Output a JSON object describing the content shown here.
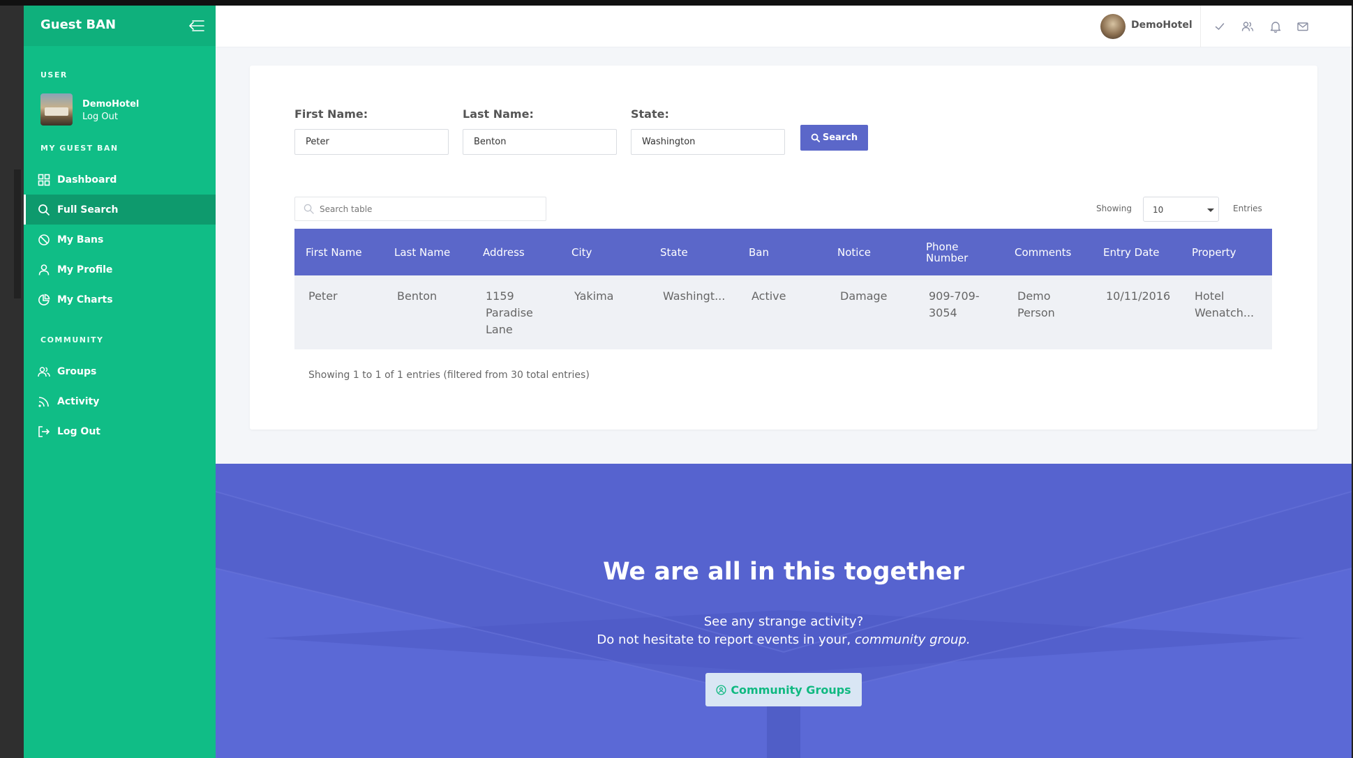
{
  "sidebar": {
    "brand": "Guest BAN",
    "user_section": "USER",
    "user": {
      "name": "DemoHotel",
      "logout": "Log Out"
    },
    "my_section": "MY GUEST BAN",
    "my_items": [
      {
        "label": "Dashboard",
        "icon": "dashboard-icon"
      },
      {
        "label": "Full Search",
        "icon": "search-icon",
        "active": true
      },
      {
        "label": "My Bans",
        "icon": "ban-icon"
      },
      {
        "label": "My Profile",
        "icon": "user-icon"
      },
      {
        "label": "My Charts",
        "icon": "pie-chart-icon"
      }
    ],
    "community_section": "COMMUNITY",
    "community_items": [
      {
        "label": "Groups",
        "icon": "users-icon"
      },
      {
        "label": "Activity",
        "icon": "rss-icon"
      },
      {
        "label": "Log Out",
        "icon": "logout-icon"
      }
    ]
  },
  "topbar": {
    "username": "DemoHotel",
    "icons": [
      "check-icon",
      "users-icon",
      "bell-icon",
      "mail-icon"
    ]
  },
  "search_form": {
    "first_name_label": "First Name:",
    "first_name_value": "Peter",
    "last_name_label": "Last Name:",
    "last_name_value": "Benton",
    "state_label": "State:",
    "state_value": "Washington",
    "search_button": "Search"
  },
  "table_controls": {
    "search_placeholder": "Search table",
    "showing_label": "Showing",
    "entries_value": "10",
    "entries_label": "Entries"
  },
  "table": {
    "columns": [
      "First Name",
      "Last Name",
      "Address",
      "City",
      "State",
      "Ban",
      "Notice",
      "Phone Number",
      "Comments",
      "Entry Date",
      "Property"
    ],
    "rows": [
      [
        "Peter",
        "Benton",
        "1159 Paradise Lane",
        "Yakima",
        "Washingt...",
        "Active",
        "Damage",
        "909-709-3054",
        "Demo Person",
        "10/11/2016",
        "Hotel Wenatch..."
      ]
    ],
    "info": "Showing 1 to 1 of 1 entries (filtered from 30 total entries)"
  },
  "footer": {
    "title": "We are all in this together",
    "line1": "See any strange activity?",
    "line2_prefix": "Do not hesitate to report events in your, ",
    "line2_emphasis": "community group.",
    "button": "Community Groups"
  },
  "colors": {
    "sidebar": "#10bd86",
    "accent": "#5b67c9",
    "footer": "#5461cc"
  }
}
